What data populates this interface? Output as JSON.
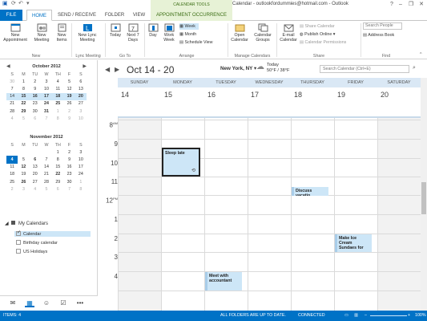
{
  "window": {
    "title": "Calendar - outlookfordummies@hotmail.com - Outlook",
    "context_group": "CALENDAR TOOLS"
  },
  "tabs": [
    "FILE",
    "HOME",
    "SEND / RECEIVE",
    "FOLDER",
    "VIEW",
    "APPOINTMENT OCCURRENCE"
  ],
  "ribbon": {
    "new": {
      "appointment": "New Appointment",
      "meeting": "New Meeting",
      "items": "New Items",
      "label": "New"
    },
    "lync": {
      "meeting": "New Lync Meeting",
      "label": "Lync Meeting"
    },
    "goto": {
      "today": "Today",
      "next7": "Next 7 Days",
      "label": "Go To"
    },
    "arrange": {
      "day": "Day",
      "workweek": "Work Week",
      "week": "Week",
      "month": "Month",
      "schedule": "Schedule View",
      "label": "Arrange"
    },
    "manage": {
      "open": "Open Calendar",
      "groups": "Calendar Groups",
      "label": "Manage Calendars"
    },
    "share": {
      "email": "E-mail Calendar",
      "sharecal": "Share Calendar",
      "publish": "Publish Online",
      "perms": "Calendar Permissions",
      "label": "Share"
    },
    "find": {
      "search_placeholder": "Search People",
      "addressbook": "Address Book",
      "label": "Find"
    }
  },
  "minical_oct": {
    "title": "October 2012",
    "dow": [
      "S",
      "M",
      "TU",
      "W",
      "TH",
      "F",
      "S"
    ],
    "weeks": [
      [
        "30",
        "1",
        "2",
        "3",
        "4",
        "5",
        "6"
      ],
      [
        "7",
        "8",
        "9",
        "10",
        "11",
        "12",
        "13"
      ],
      [
        "14",
        "15",
        "16",
        "17",
        "18",
        "19",
        "20"
      ],
      [
        "21",
        "22",
        "23",
        "24",
        "25",
        "26",
        "27"
      ],
      [
        "28",
        "29",
        "30",
        "31",
        "1",
        "2",
        "3"
      ],
      [
        "4",
        "5",
        "6",
        "7",
        "8",
        "9",
        "10"
      ]
    ]
  },
  "minical_nov": {
    "title": "November 2012",
    "dow": [
      "S",
      "M",
      "TU",
      "W",
      "TH",
      "F",
      "S"
    ],
    "weeks": [
      [
        "",
        "",
        "",
        "",
        "1",
        "2",
        "3"
      ],
      [
        "4",
        "5",
        "6",
        "7",
        "8",
        "9",
        "10"
      ],
      [
        "11",
        "12",
        "13",
        "14",
        "15",
        "16",
        "17"
      ],
      [
        "18",
        "19",
        "20",
        "21",
        "22",
        "23",
        "24"
      ],
      [
        "25",
        "26",
        "27",
        "28",
        "29",
        "30",
        "1"
      ],
      [
        "2",
        "3",
        "4",
        "5",
        "6",
        "7",
        "8"
      ]
    ]
  },
  "calendars": {
    "group": "My Calendars",
    "items": [
      {
        "label": "Calendar",
        "checked": true
      },
      {
        "label": "Birthday calendar",
        "checked": false
      },
      {
        "label": "US Holidays",
        "checked": false
      }
    ]
  },
  "header": {
    "range": "Oct 14 - 20",
    "location": "New York, NY",
    "weather_day": "Today",
    "weather_temp": "50°F / 38°F",
    "search_placeholder": "Search Calendar (Ctrl+E)"
  },
  "days": [
    {
      "name": "SUNDAY",
      "num": "14"
    },
    {
      "name": "MONDAY",
      "num": "15"
    },
    {
      "name": "TUESDAY",
      "num": "16"
    },
    {
      "name": "WEDNESDAY",
      "num": "17"
    },
    {
      "name": "THURSDAY",
      "num": "18"
    },
    {
      "name": "FRIDAY",
      "num": "19"
    },
    {
      "name": "SATURDAY",
      "num": "20"
    }
  ],
  "hours": [
    "8",
    "9",
    "10",
    "11",
    "12",
    "1",
    "2",
    "3",
    "4"
  ],
  "hour_suffix": {
    "8": "AM",
    "12": "PM"
  },
  "appointments": {
    "sleep": "Sleep late",
    "discuss": "Discuss vacatio",
    "icecream": "Make Ice Cream Sundaes for",
    "accountant": "Meet with accountant"
  },
  "status": {
    "items": "ITEMS: 4",
    "folders": "ALL FOLDERS ARE UP TO DATE.",
    "connected": "CONNECTED",
    "zoom": "100%"
  },
  "colors": {
    "accent": "#0072c6",
    "appointment": "#cde6f7",
    "context": "#3b6e14"
  }
}
